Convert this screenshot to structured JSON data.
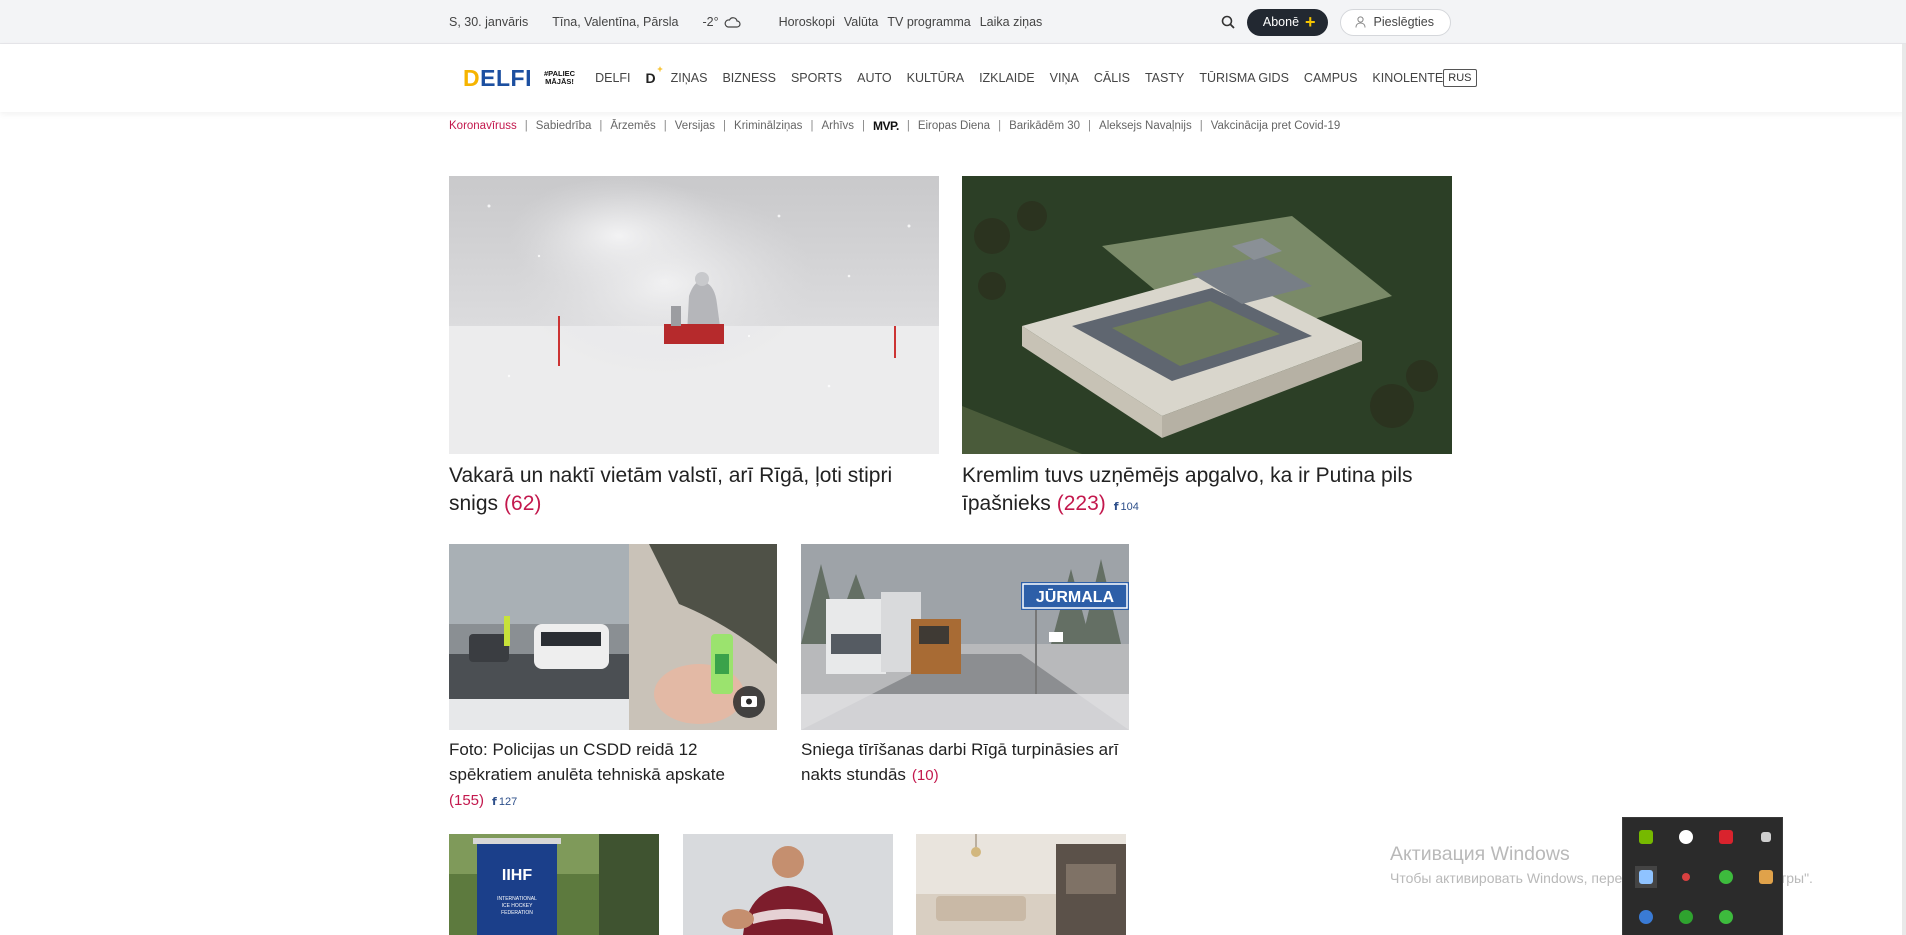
{
  "topbar": {
    "date": "S, 30. janvāris",
    "namedays": "Tīna, Valentīna, Pārsla",
    "temperature": "-2°",
    "weather_icon": "cloud-icon",
    "links": [
      "Horoskopi",
      "Valūta",
      "TV programma",
      "Laika ziņas"
    ],
    "subscribe_label": "Abonē",
    "login_label": "Pieslēgties"
  },
  "nav": {
    "logo_text": "DELFI",
    "tagline_line1": "#PALIEC",
    "tagline_line2": "MĀJĀS!",
    "items": [
      "DELFI",
      "D",
      "ZIŅAS",
      "BIZNESS",
      "SPORTS",
      "AUTO",
      "KULTŪRA",
      "IZKLAIDE",
      "VIŅA",
      "CĀLIS",
      "TASTY",
      "TŪRISMA GIDS",
      "CAMPUS",
      "KINOLENTE"
    ],
    "dplus_sup": "+",
    "rus_label": "RUS"
  },
  "topics": {
    "items": [
      "Koronavīruss",
      "Sabiedrība",
      "Ārzemēs",
      "Versijas",
      "Kriminālziņas",
      "Arhīvs",
      "MVP.",
      "Eiropas Diena",
      "Barikādēm 30",
      "Aleksejs Navaļnijs",
      "Vakcinācija pret Covid-19"
    ]
  },
  "articles": {
    "a1": {
      "title": "Vakarā un naktī vietām valstī, arī Rīgā, ļoti stipri snigs",
      "comments": "(62)"
    },
    "a2": {
      "title": "Kremlim tuvs uzņēmējs apgalvo, ka ir Putina pils īpašnieks",
      "comments": "(223)",
      "fb": "104"
    },
    "a3": {
      "title": "Foto: Policijas un CSDD reidā 12 spēkratiem anulēta tehniskā apskate",
      "comments": "(155)",
      "fb": "127"
    },
    "a4": {
      "title": "Sniega tīrīšanas darbi Rīgā turpināsies arī nakts stundās",
      "comments": "(10)",
      "sign_text": "JŪRMALA"
    },
    "a5": {
      "sign_line1": "IIHF",
      "sign_line2": "INTERNATIONAL",
      "sign_line3": "ICE HOCKEY",
      "sign_line4": "FEDERATION"
    }
  },
  "windows": {
    "activate_title": "Активация Windows",
    "activate_sub": "Чтобы активировать Windows, перейдите в раздел \"Параметры\"."
  },
  "colors": {
    "accent": "#c3184d",
    "logo_blue": "#1c4fa0",
    "logo_yellow": "#f6b400",
    "subscribe_bg": "#222831"
  }
}
